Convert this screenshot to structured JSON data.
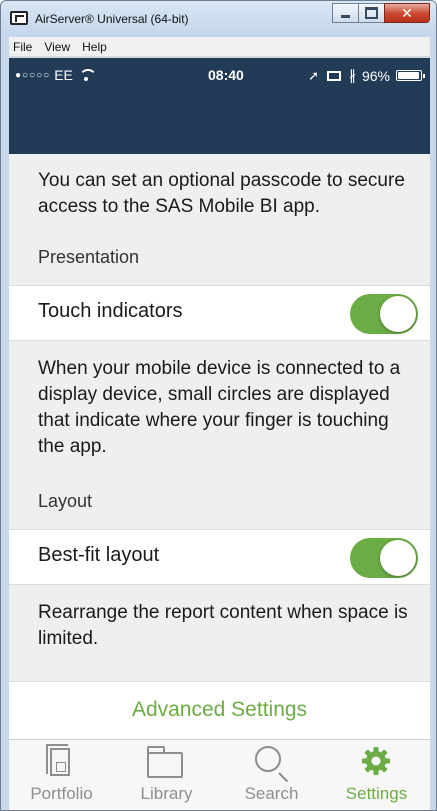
{
  "window": {
    "title": "AirServer® Universal (64-bit)",
    "close_label": "✕",
    "menu": [
      "File",
      "View",
      "Help"
    ]
  },
  "status_bar": {
    "signal": "●○○○○",
    "carrier": "EE",
    "time": "08:40",
    "location_glyph": "➚",
    "bluetooth_glyph": "∦",
    "battery": "96%"
  },
  "settings": {
    "passcode_description": "You can set an optional passcode to secure access to the SAS Mobile BI app.",
    "presentation_header": "Presentation",
    "touch_indicators_label": "Touch indicators",
    "touch_indicators_on": true,
    "touch_description": "When your mobile device is connected to a display device, small circles are displayed that indicate where your finger is touching the app.",
    "layout_header": "Layout",
    "best_fit_label": "Best-fit layout",
    "best_fit_on": true,
    "best_fit_description": "Rearrange the report content when space is limited.",
    "advanced_settings_label": "Advanced Settings"
  },
  "tabs": [
    {
      "label": "Portfolio",
      "icon": "portfolio-icon",
      "active": false
    },
    {
      "label": "Library",
      "icon": "folder-icon",
      "active": false
    },
    {
      "label": "Search",
      "icon": "search-icon",
      "active": false
    },
    {
      "label": "Settings",
      "icon": "gear-icon",
      "active": true
    }
  ],
  "colors": {
    "accent": "#6cac44",
    "navbar": "#223b57",
    "inactive_tab": "#8e8e8e"
  }
}
